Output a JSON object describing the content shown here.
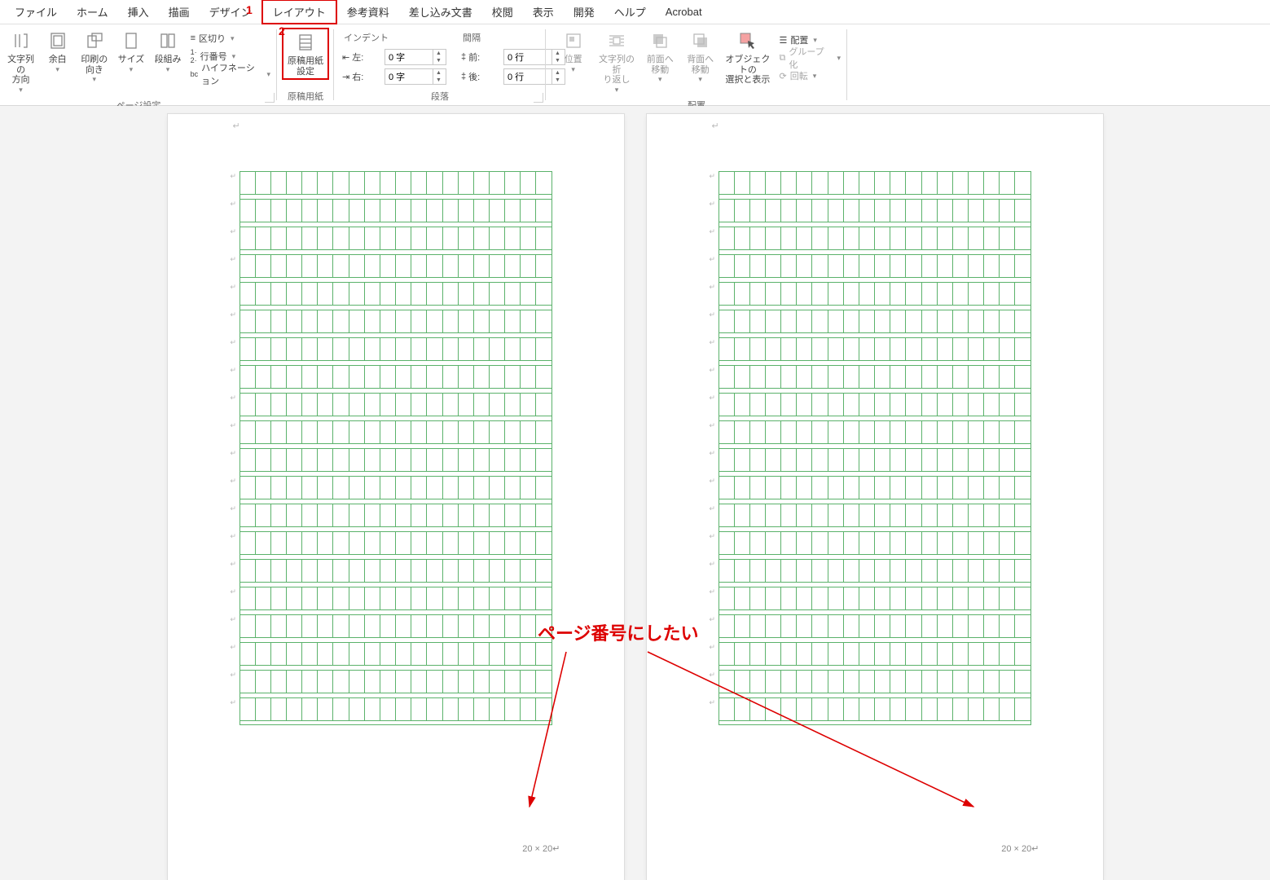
{
  "callouts": {
    "one": "1",
    "two": "2"
  },
  "tabs": {
    "file": "ファイル",
    "home": "ホーム",
    "insert": "挿入",
    "draw": "描画",
    "design": "デザイン",
    "layout": "レイアウト",
    "references": "参考資料",
    "mailings": "差し込み文書",
    "review": "校閲",
    "view": "表示",
    "developer": "開発",
    "help": "ヘルプ",
    "acrobat": "Acrobat"
  },
  "page_setup": {
    "text_direction": "文字列の\n方向",
    "margins": "余白",
    "orientation": "印刷の\n向き",
    "size": "サイズ",
    "columns": "段組み",
    "breaks": "区切り",
    "line_numbers": "行番号",
    "hyphenation": "ハイフネーション",
    "group": "ページ設定"
  },
  "genko": {
    "button": "原稿用紙\n設定",
    "group": "原稿用紙"
  },
  "paragraph": {
    "indent_title": "インデント",
    "spacing_title": "間隔",
    "left_label": "左:",
    "right_label": "右:",
    "before_label": "前:",
    "after_label": "後:",
    "left_value": "0 字",
    "right_value": "0 字",
    "before_value": "0 行",
    "after_value": "0 行",
    "group": "段落"
  },
  "arrange": {
    "position": "位置",
    "wrap": "文字列の折\nり返し",
    "bring_forward": "前面へ\n移動",
    "send_backward": "背面へ\n移動",
    "selection_pane": "オブジェクトの\n選択と表示",
    "align": "配置",
    "group_obj": "グループ化",
    "rotate": "回転",
    "group": "配置"
  },
  "annotation": {
    "text": "ページ番号にしたい"
  },
  "page_footer": "20 × 20↵"
}
